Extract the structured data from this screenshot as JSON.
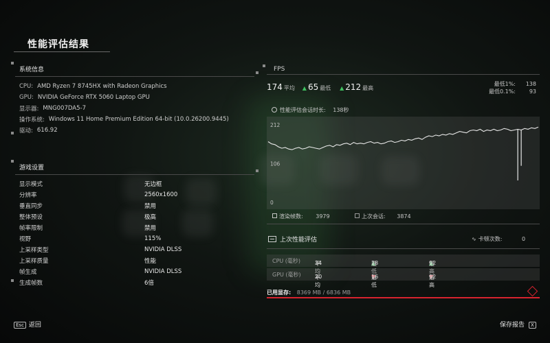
{
  "page_title": "性能评估结果",
  "system": {
    "heading": "系统信息",
    "rows": [
      {
        "k": "CPU:",
        "v": "AMD Ryzen 7 8745HX with Radeon Graphics"
      },
      {
        "k": "GPU:",
        "v": "NVIDIA GeForce RTX 5060 Laptop GPU"
      },
      {
        "k": "显示器:",
        "v": "MNG007DA5-7"
      },
      {
        "k": "操作系统:",
        "v": "Windows 11 Home Premium Edition 64-bit (10.0.26200.9445)"
      },
      {
        "k": "驱动:",
        "v": "616.92"
      }
    ]
  },
  "game": {
    "heading": "游戏设置",
    "rows": [
      {
        "k": "显示模式",
        "v": "无边框"
      },
      {
        "k": "分辨率",
        "v": "2560x1600"
      },
      {
        "k": "垂直同步",
        "v": "禁用"
      },
      {
        "k": "整体预设",
        "v": "极高"
      },
      {
        "k": "帧率限制",
        "v": "禁用"
      },
      {
        "k": "视野",
        "v": "115%"
      },
      {
        "k": "上采样类型",
        "v": "NVIDIA DLSS"
      },
      {
        "k": "上采样质量",
        "v": "性能"
      },
      {
        "k": "帧生成",
        "v": "NVIDIA DLSS"
      },
      {
        "k": "生成帧数",
        "v": "6倍"
      }
    ]
  },
  "fps": {
    "heading": "FPS",
    "avg": "174",
    "avg_label": "平均",
    "min": "65",
    "min_label": "最低",
    "max": "212",
    "max_label": "最高",
    "low1_label": "最低1%:",
    "low1": "138",
    "low01_label": "最低0.1%:",
    "low01": "93",
    "session_label": "性能评估会话时长:",
    "session_value": "138秒",
    "rendered_label": "渲染帧数:",
    "rendered_value": "3979",
    "last_label": "上次会话:",
    "last_value": "3874"
  },
  "chart_data": {
    "type": "line",
    "y_ticks": [
      "212",
      "106",
      "0"
    ],
    "ylim": [
      0,
      212
    ],
    "grid": false,
    "series": [
      {
        "values": [
          166,
          160,
          158,
          152,
          148,
          150,
          146,
          144,
          148,
          150,
          146,
          148,
          152,
          150,
          148,
          146,
          150,
          154,
          156,
          152,
          158,
          156,
          160,
          162,
          158,
          164,
          160,
          162,
          160,
          164,
          166,
          162,
          164,
          160,
          162,
          166,
          168,
          164,
          166,
          170,
          168,
          172,
          170,
          174,
          176,
          172,
          178,
          182,
          180,
          184,
          182,
          186,
          184,
          188,
          186,
          190,
          194,
          192,
          190,
          196,
          198,
          196,
          200,
          194,
          198,
          196,
          200,
          196,
          198,
          202,
          200,
          196,
          198,
          200,
          198,
          202,
          200,
          204,
          202,
          206
        ]
      }
    ],
    "spikes": [
      {
        "index": 73,
        "value": 60
      },
      {
        "index": 74,
        "value": 100
      }
    ]
  },
  "last_perf": {
    "heading": "上次性能评估",
    "stutter_label": "卡顿次数:",
    "stutter_value": "0",
    "rows": [
      {
        "label": "CPU (毫秒)",
        "avg": "34",
        "avg_label": "平均",
        "min": "28",
        "min_label": "最低",
        "max": "92",
        "max_label": "最高",
        "min_trend": "up",
        "max_trend": "up"
      },
      {
        "label": "GPU (毫秒)",
        "avg": "20",
        "avg_label": "平均",
        "min": "16",
        "min_label": "最低",
        "max": "92",
        "max_label": "最高",
        "min_trend": "down",
        "max_trend": "down"
      }
    ]
  },
  "vram": {
    "label": "已用显存:",
    "value": "8369 MB / 6836 MB"
  },
  "footer": {
    "back_key": "Esc",
    "back_label": "返回",
    "save_label": "保存报告",
    "save_key": "X"
  },
  "colors": {
    "accent_green": "#3fbf5f",
    "accent_red": "#d8232f"
  }
}
